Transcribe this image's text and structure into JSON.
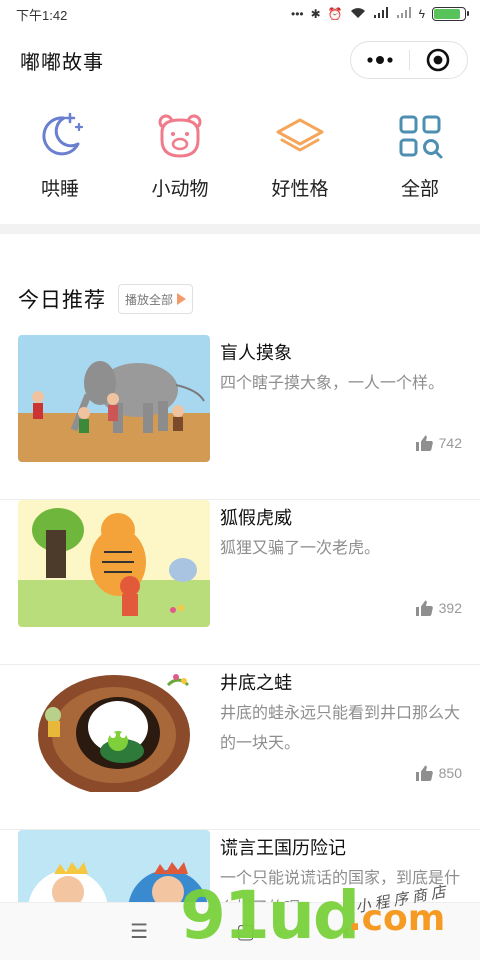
{
  "status_bar": {
    "time": "下午1:42"
  },
  "nav": {
    "title": "嘟嘟故事"
  },
  "categories": [
    {
      "label": "哄睡",
      "icon": "moon-stars-icon"
    },
    {
      "label": "小动物",
      "icon": "bear-face-icon"
    },
    {
      "label": "好性格",
      "icon": "layers-icon"
    },
    {
      "label": "全部",
      "icon": "grid-search-icon"
    }
  ],
  "section": {
    "title": "今日推荐",
    "play_all": "播放全部"
  },
  "stories": [
    {
      "title": "盲人摸象",
      "desc": "四个瞎子摸大象，一人一个样。",
      "likes": "742"
    },
    {
      "title": "狐假虎威",
      "desc": "狐狸又骗了一次老虎。",
      "likes": "392"
    },
    {
      "title": "井底之蛙",
      "desc": "井底的蛙永远只能看到井口那么大的一块天。",
      "likes": "850"
    },
    {
      "title": "谎言王国历险记",
      "desc": "一个只能说谎话的国家，到底是什么样子的呢?",
      "likes": ""
    }
  ],
  "bottom_nav": {
    "menu": "☰",
    "home": "▢",
    "back": "‹"
  },
  "watermark": {
    "main": "91ud",
    "suffix": ".com",
    "shop": "小程序商店"
  },
  "colors": {
    "icon_blue": "#6a7fd0",
    "icon_pink": "#f07b8b",
    "icon_orange": "#f5a65b",
    "icon_teal": "#4c8fb3",
    "play_triangle": "#f39a6b"
  }
}
